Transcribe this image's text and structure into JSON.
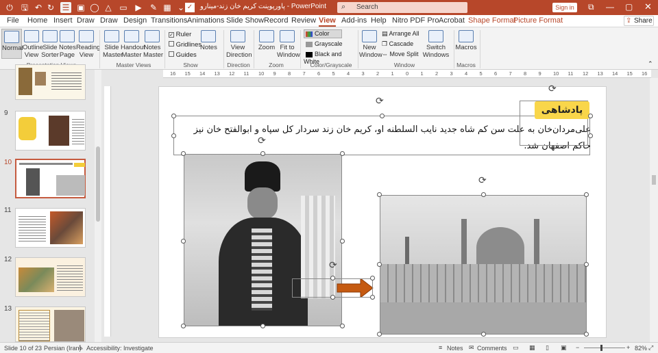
{
  "titlebar": {
    "doc_title": "پاورپوینت کریم خان زند-مینارو - PowerPoint",
    "search_placeholder": "Search",
    "signin": "Sign in",
    "accent": "#b7472a"
  },
  "tabs": [
    "File",
    "Home",
    "Insert",
    "Draw",
    "Draw",
    "Design",
    "Transitions",
    "Animations",
    "Slide Show",
    "Record",
    "Review",
    "View",
    "Add-ins",
    "Help",
    "Nitro PDF Pro",
    "Acrobat",
    "Shape Format",
    "Picture Format"
  ],
  "share": "Share",
  "ribbon": {
    "presentation_views": {
      "label": "Presentation Views",
      "items": [
        "Normal",
        "Outline View",
        "Slide Sorter",
        "Notes Page",
        "Reading View"
      ]
    },
    "master_views": {
      "label": "Master Views",
      "items": [
        "Slide Master",
        "Handout Master",
        "Notes Master"
      ]
    },
    "show": {
      "label": "Show",
      "ruler": "Ruler",
      "gridlines": "Gridlines",
      "guides": "Guides",
      "notes": "Notes"
    },
    "direction": {
      "label": "Direction",
      "item": "View Direction"
    },
    "zoom": {
      "label": "Zoom",
      "zoom": "Zoom",
      "fit": "Fit to Window"
    },
    "color": {
      "label": "Color/Grayscale",
      "color": "Color",
      "grayscale": "Grayscale",
      "bw": "Black and White"
    },
    "window": {
      "label": "Window",
      "new": "New Window",
      "arrange": "Arrange All",
      "cascade": "Cascade",
      "move": "Move Split",
      "switch": "Switch Windows"
    },
    "macros": {
      "label": "Macros",
      "item": "Macros"
    }
  },
  "ruler_ticks": [
    "16",
    "15",
    "14",
    "13",
    "12",
    "11",
    "10",
    "9",
    "8",
    "7",
    "6",
    "5",
    "4",
    "3",
    "2",
    "1",
    "0",
    "1",
    "2",
    "3",
    "4",
    "5",
    "6",
    "7",
    "8",
    "9",
    "10",
    "11",
    "12",
    "13",
    "14",
    "15",
    "16"
  ],
  "thumbnails": [
    {
      "num": "9"
    },
    {
      "num": "10"
    },
    {
      "num": "11"
    },
    {
      "num": "12"
    },
    {
      "num": "13"
    }
  ],
  "slide": {
    "title": "پادشاهی",
    "body": "علی‌مردان‌خان به علت سن کم شاه جدید نایب السلطنه او، کریم خان زند سردار کل سپاه و ابوالفتح خان نیز حاکم اصفهان شد."
  },
  "status": {
    "slide_of": "Slide 10 of 23",
    "language": "Persian (Iran)",
    "accessibility": "Accessibility: Investigate",
    "notes": "Notes",
    "comments": "Comments",
    "zoom": "82%"
  }
}
